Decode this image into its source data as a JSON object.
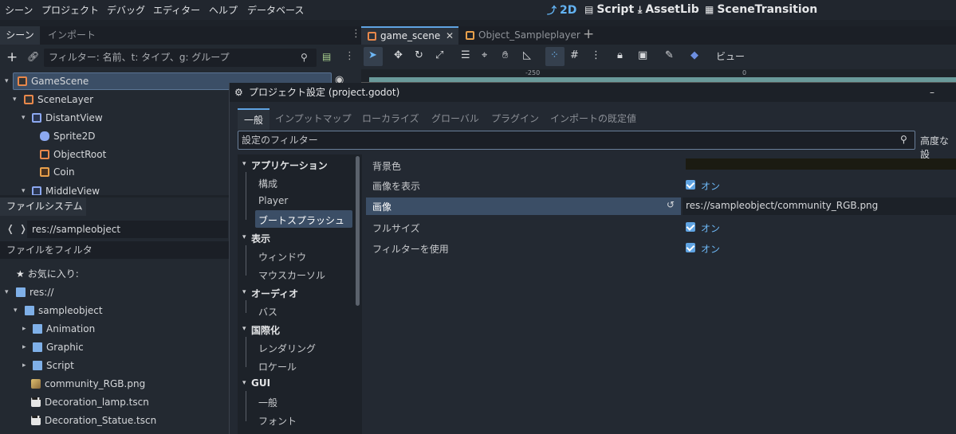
{
  "menubar": {
    "items": [
      "シーン",
      "プロジェクト",
      "デバッグ",
      "エディター",
      "ヘルプ",
      "データベース"
    ],
    "workspaces": [
      {
        "label": "2D",
        "icon": "2d-icon",
        "active": true
      },
      {
        "label": "Script",
        "icon": "script-icon",
        "active": false
      },
      {
        "label": "AssetLib",
        "icon": "assetlib-icon",
        "active": false
      },
      {
        "label": "SceneTransition",
        "icon": "scene-transition-icon",
        "active": false
      }
    ]
  },
  "scene_dock": {
    "tabs": [
      "シーン",
      "インポート"
    ],
    "filter_placeholder": "フィルター: 名前、t: タイプ、g: グループ",
    "nodes": [
      {
        "label": "GameScene"
      },
      {
        "label": "SceneLayer"
      },
      {
        "label": "DistantView"
      },
      {
        "label": "Sprite2D"
      },
      {
        "label": "ObjectRoot"
      },
      {
        "label": "Coin"
      },
      {
        "label": "MiddleView"
      }
    ]
  },
  "filesystem": {
    "title": "ファイルシステム",
    "path": "res://sampleobject",
    "filter_placeholder": "ファイルをフィルタ",
    "items": [
      {
        "label": "お気に入り:"
      },
      {
        "label": "res://"
      },
      {
        "label": "sampleobject"
      },
      {
        "label": "Animation"
      },
      {
        "label": "Graphic"
      },
      {
        "label": "Script"
      },
      {
        "label": "community_RGB.png"
      },
      {
        "label": "Decoration_lamp.tscn"
      },
      {
        "label": "Decoration_Statue.tscn"
      }
    ]
  },
  "editor_tabs": [
    "game_scene",
    "Object_Sampleplayer"
  ],
  "toolbar": {
    "view_label": "ビュー"
  },
  "ruler": {
    "labels": [
      "-250",
      "0"
    ]
  },
  "dialog": {
    "title": "プロジェクト設定 (project.godot)",
    "tabs": [
      "一般",
      "インプットマップ",
      "ローカライズ",
      "グローバル",
      "プラグイン",
      "インポートの既定値"
    ],
    "filter_placeholder": "設定のフィルター",
    "advanced_label": "高度な設",
    "categories": [
      {
        "label": "アプリケーション",
        "items": [
          "構成",
          "Player",
          "ブートスプラッシュ"
        ]
      },
      {
        "label": "表示",
        "items": [
          "ウィンドウ",
          "マウスカーソル"
        ]
      },
      {
        "label": "オーディオ",
        "items": [
          "バス"
        ]
      },
      {
        "label": "国際化",
        "items": [
          "レンダリング",
          "ロケール"
        ]
      },
      {
        "label": "GUI",
        "items": [
          "一般",
          "フォント"
        ]
      }
    ],
    "properties": {
      "bg_color": {
        "label": "背景色"
      },
      "show_image": {
        "label": "画像を表示",
        "value": "オン"
      },
      "image": {
        "label": "画像",
        "value": "res://sampleobject/community_RGB.png"
      },
      "fullsize": {
        "label": "フルサイズ",
        "value": "オン"
      },
      "use_filter": {
        "label": "フィルターを使用",
        "value": "オン"
      }
    }
  }
}
